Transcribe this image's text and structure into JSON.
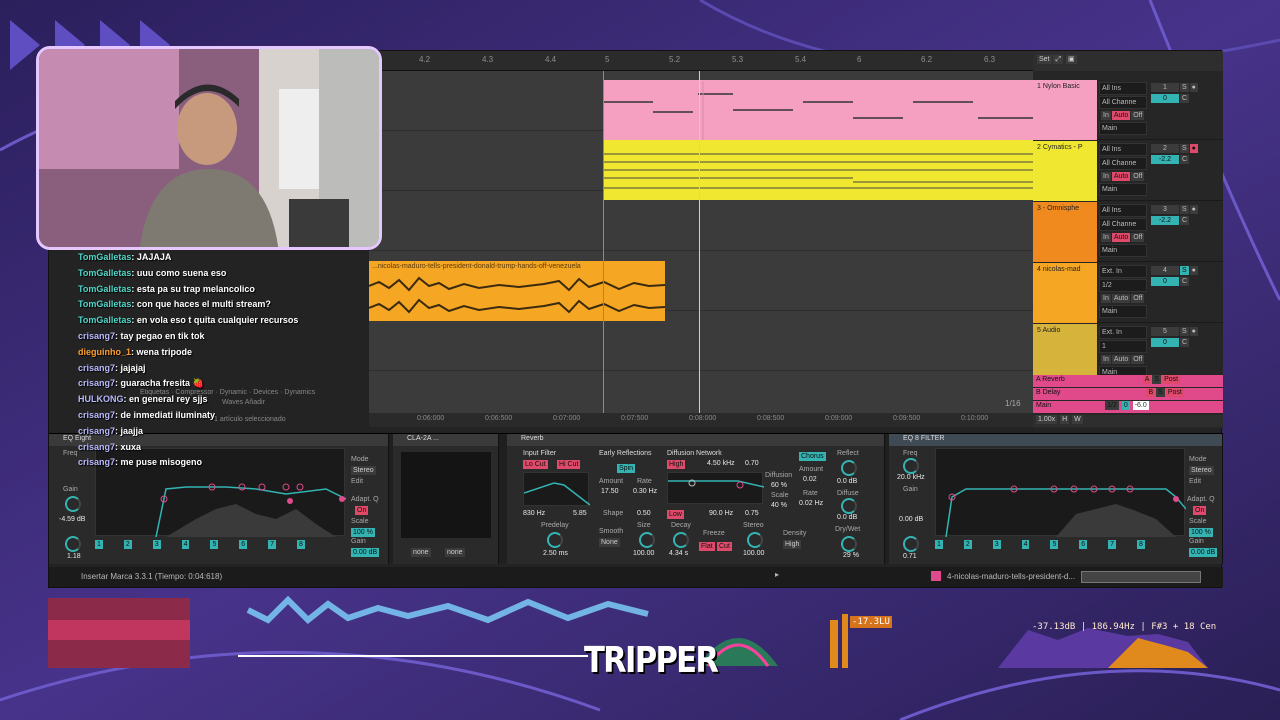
{
  "ruler": {
    "ticks": [
      "4.2",
      "4.3",
      "4.4",
      "5",
      "5.2",
      "5.3",
      "5.4",
      "6",
      "6.2",
      "6.3"
    ],
    "set_label": "Set"
  },
  "tracks": [
    {
      "name": "1 Nylon Basic",
      "input": "All Ins",
      "channel": "All Channe",
      "monitor": [
        "In",
        "Auto",
        "Off"
      ],
      "output": "Main",
      "vol": "0",
      "pan": "C"
    },
    {
      "name": "2 Cymatics - P",
      "input": "All Ins",
      "channel": "All Channe",
      "monitor": [
        "In",
        "Auto",
        "Off"
      ],
      "output": "Main",
      "vol": "-2.2",
      "pan": "C"
    },
    {
      "name": "3 - Omnisphe",
      "input": "All Ins",
      "channel": "All Channe",
      "monitor": [
        "In",
        "Auto",
        "Off"
      ],
      "output": "Main",
      "vol": "-2.2",
      "pan": "C"
    },
    {
      "name": "4 nicolas-mad",
      "input": "Ext. In",
      "channel": "1/2",
      "monitor": [
        "In",
        "Auto",
        "Off"
      ],
      "output": "Main",
      "vol": "0",
      "pan": "C"
    },
    {
      "name": "5 Audio",
      "input": "Ext. In",
      "channel": "1",
      "monitor": [
        "In",
        "Auto",
        "Off"
      ],
      "output": "Main",
      "vol": "0",
      "pan": "C"
    }
  ],
  "returns": [
    {
      "name": "A Reverb",
      "letter": "A",
      "post": "Post"
    },
    {
      "name": "B Delay",
      "letter": "B",
      "post": "Post"
    },
    {
      "name": "Main",
      "output": "1/2",
      "vol": "0",
      "db": "-6.0"
    }
  ],
  "audio_clip_title": "...nicolas-maduro-tells-president-donald-trump-hands-off-venezuela",
  "timeline2": {
    "ticks": [
      "0:06:000",
      "0:06:500",
      "0:07:000",
      "0:07:500",
      "0:08:000",
      "0:08:500",
      "0:09:000",
      "0:09:500",
      "0:10:000"
    ],
    "quantize": "1/16"
  },
  "zoom": {
    "value": "1.00x",
    "h": "H",
    "w": "W"
  },
  "chat": [
    {
      "user": "TomGalletas",
      "msg": ": JAJAJA"
    },
    {
      "user": "TomGalletas",
      "msg": ": uuu como suena eso"
    },
    {
      "user": "TomGalletas",
      "msg": ": esta pa su trap melancolico"
    },
    {
      "user": "TomGalletas",
      "msg": ": con que haces el multi stream?"
    },
    {
      "user": "TomGalletas",
      "msg": ": en vola eso t quita cualquier recursos"
    },
    {
      "user": "crisang7",
      "msg": ": tay pegao en tik tok"
    },
    {
      "user": "dieguinho_1",
      "msg": ": wena tripode"
    },
    {
      "user": "crisang7",
      "msg": ": jajajaj"
    },
    {
      "user": "crisang7",
      "msg": ": guaracha fresita 🍓"
    },
    {
      "user": "HULKONG",
      "msg": ": en general rey sjjs"
    },
    {
      "user": "crisang7",
      "msg": ": de inmediati iluminaty"
    },
    {
      "user": "crisang7",
      "msg": ": jaajja"
    },
    {
      "user": "crisang7",
      "msg": ": xuxa"
    },
    {
      "user": "crisang7",
      "msg": ": me puse misogeno"
    }
  ],
  "browser_tabs": [
    "Etiquetas",
    "Compressor",
    "Dynamic",
    "Devices",
    "Dynamics",
    "Waves",
    "Añadir"
  ],
  "browser_status": "1 artículo seleccionado",
  "eq1": {
    "title": "EQ Eight",
    "freq_label": "Freq",
    "gain_label": "Gain",
    "gain_val": "-4.59 dB",
    "q_val": "1.18",
    "mode_label": "Mode",
    "mode_val": "Stereo",
    "edit": "Edit",
    "adapt": "Adapt. Q",
    "adapt_val": "On",
    "scale_label": "Scale",
    "scale_val": "100 %",
    "out_gain_label": "Gain",
    "out_gain_val": "0.00 dB",
    "bands": [
      "1",
      "2",
      "3",
      "4",
      "5",
      "6",
      "7",
      "8"
    ]
  },
  "cla": {
    "title": "CLA-2A ...",
    "sel1": "none",
    "sel2": "none"
  },
  "reverb": {
    "title": "Reverb",
    "input_filter": "Input Filter",
    "lowcut": "Lo Cut",
    "hicut": "Hi Cut",
    "freq": "830 Hz",
    "width": "5.85",
    "predelay_label": "Predelay",
    "predelay_val": "2.50 ms",
    "early": "Early Reflections",
    "spin": "Spin",
    "amount_label": "Amount",
    "amount_val": "17.50",
    "rate_label": "Rate",
    "rate_val": "0.30 Hz",
    "shape_label": "Shape",
    "shape_val": "0.50",
    "smooth_label": "Smooth",
    "smooth_val": "None",
    "size_label": "Size",
    "size_val": "100.00",
    "diffusion": "Diffusion Network",
    "high": "High",
    "hfreq": "4.50 kHz",
    "hval": "0.70",
    "low": "Low",
    "lfreq": "90.0 Hz",
    "lval": "0.75",
    "diff_label": "Diffusion",
    "diff_val": "60 %",
    "scale_label": "Scale",
    "scale_val": "40 %",
    "chorus": "Chorus",
    "c_amount_label": "Amount",
    "c_amount_val": "0.02",
    "c_rate_label": "Rate",
    "c_rate_val": "0.02 Hz",
    "decay_label": "Decay",
    "decay_val": "4.34 s",
    "freeze_label": "Freeze",
    "flat": "Flat",
    "cut": "Cut",
    "stereo_label": "Stereo",
    "stereo_val": "100.00",
    "density_label": "Density",
    "density_val": "High",
    "reflect_label": "Reflect",
    "reflect_val": "0.0 dB",
    "diffuse_label": "Diffuse",
    "diffuse_val": "0.0 dB",
    "drywet_label": "Dry/Wet",
    "drywet_val": "29 %"
  },
  "eq2": {
    "title": "EQ 8 FILTER",
    "freq_label": "Freq",
    "freq_val": "20.0 kHz",
    "gain_label": "Gain",
    "gain_val": "0.00 dB",
    "q_val": "0.71",
    "mode_label": "Mode",
    "mode_val": "Stereo",
    "edit": "Edit",
    "adapt": "Adapt. Q",
    "adapt_val": "On",
    "scale_label": "Scale",
    "scale_val": "100 %",
    "out_gain_label": "Gain",
    "out_gain_val": "0.00 dB",
    "bands": [
      "1",
      "2",
      "3",
      "4",
      "5",
      "6",
      "7",
      "8"
    ]
  },
  "status": {
    "left": "Insertar Marca 3.3.1 (Tiempo: 0:04:618)",
    "right": "4-nicolas-maduro-tells-president-d..."
  },
  "meters": {
    "lu": "-17.3LU",
    "spectrum": "-37.13dB | 186.94Hz | F#3 + 18 Cen"
  },
  "logo": "TRIPPER",
  "colors": {
    "accent_teal": "#34b3b3",
    "clip_pink": "#f5a0c0",
    "clip_yellow": "#f0e830",
    "clip_orange": "#f5a623",
    "track_orange": "#f08a1e",
    "track_gold": "#d6b33a",
    "bg_purple": "#3a2a6e"
  }
}
